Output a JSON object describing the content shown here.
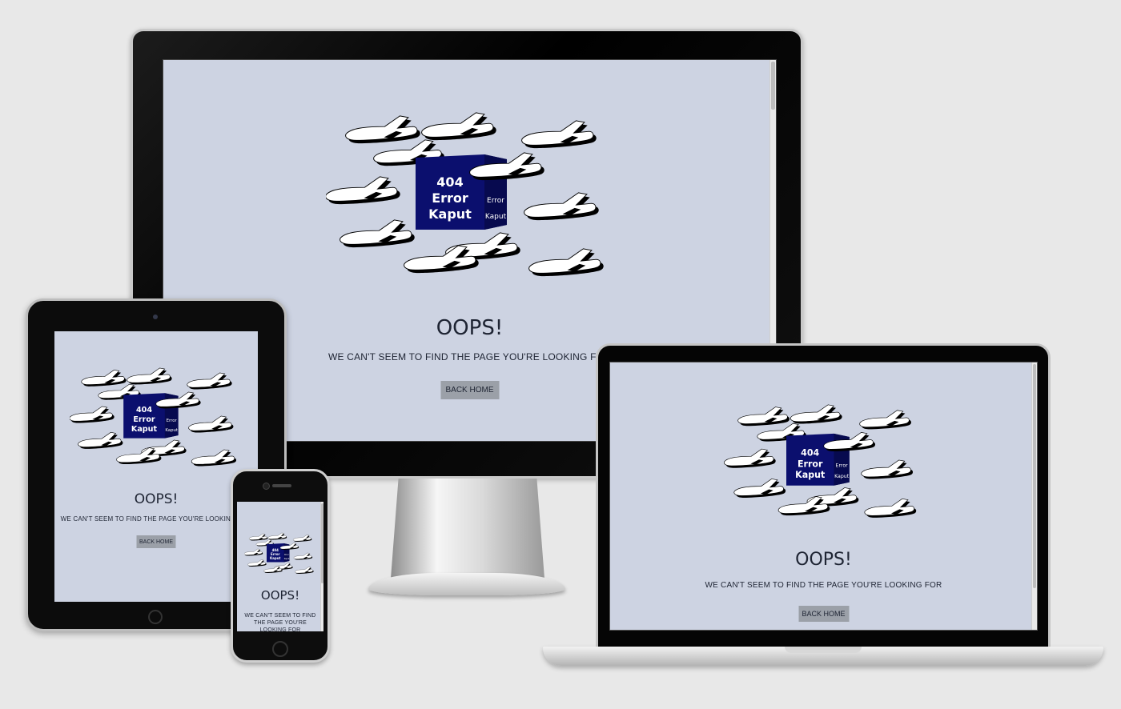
{
  "page": {
    "heading": "OOPS!",
    "message": "WE CAN'T SEEM TO FIND THE PAGE YOU'RE LOOKING FOR",
    "button_label": "BACK HOME"
  },
  "illustration": {
    "lines": [
      "404",
      "Error",
      "Kaput"
    ],
    "mirror_lines": [
      "Error",
      "Kaput"
    ],
    "box_color": "#0b0f6e"
  },
  "devices": [
    "monitor",
    "tablet",
    "phone",
    "laptop"
  ],
  "colors": {
    "background": "#e8e8e8",
    "screen_bg": "#cdd3e2",
    "button_bg": "#9ba0a8",
    "text": "#1e2433"
  }
}
